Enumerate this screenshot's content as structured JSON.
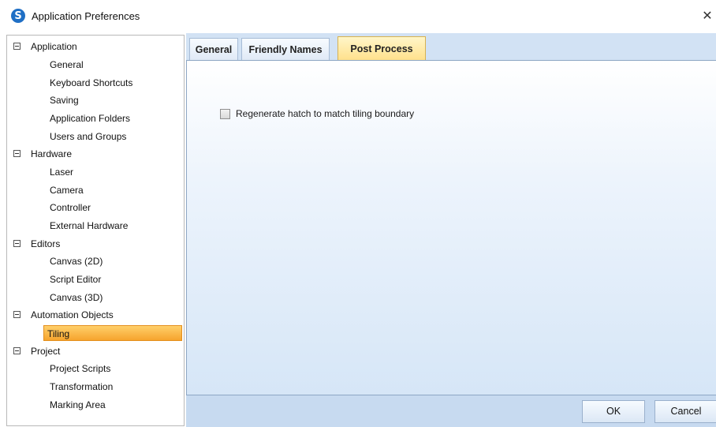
{
  "window": {
    "title": "Application Preferences",
    "close_glyph": "✕",
    "app_icon": "S"
  },
  "tree": {
    "categories": [
      {
        "label": "Application",
        "children": [
          "General",
          "Keyboard Shortcuts",
          "Saving",
          "Application Folders",
          "Users and Groups"
        ]
      },
      {
        "label": "Hardware",
        "children": [
          "Laser",
          "Camera",
          "Controller",
          "External Hardware"
        ]
      },
      {
        "label": "Editors",
        "children": [
          "Canvas (2D)",
          "Script Editor",
          "Canvas (3D)"
        ]
      },
      {
        "label": "Automation Objects",
        "children": [
          "Tiling"
        ]
      },
      {
        "label": "Project",
        "children": [
          "Project Scripts",
          "Transformation",
          "Marking Area"
        ]
      }
    ],
    "selected": "Tiling"
  },
  "tabs": [
    {
      "label": "General",
      "active": false
    },
    {
      "label": "Friendly Names",
      "active": false
    },
    {
      "label": "Post Process",
      "active": true
    }
  ],
  "post_process": {
    "regenerate_hatch_label": "Regenerate hatch to match tiling boundary",
    "regenerate_hatch_checked": false
  },
  "buttons": {
    "ok_label": "OK",
    "cancel_label": "Cancel"
  },
  "colors": {
    "accent_selected": "#f6a42d",
    "active_tab": "#ffe08a",
    "panel_blue": "#d2e2f4"
  }
}
